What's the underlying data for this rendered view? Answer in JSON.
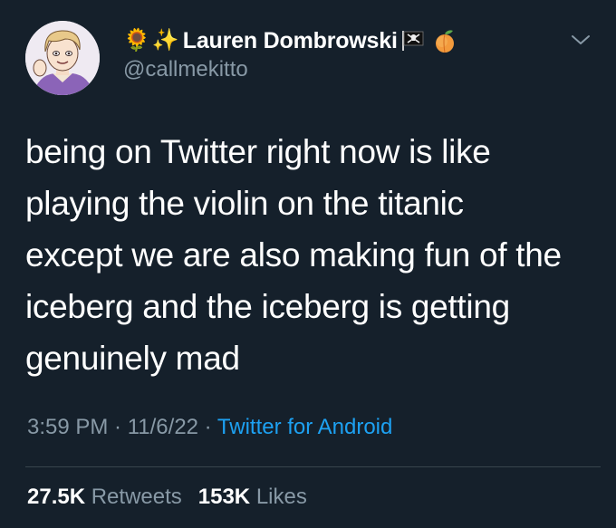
{
  "author": {
    "prefix_emojis": [
      "🌻",
      "✨"
    ],
    "display_name": "Lauren Dombrowski",
    "suffix_icons": [
      "pirate-flag-icon",
      "peach-icon"
    ],
    "handle": "@callmekitto"
  },
  "tweet": {
    "lines": [
      "being on Twitter right now is like",
      "playing the violin on the titanic",
      "except we are also making fun of the",
      "iceberg and the iceberg is getting",
      "genuinely mad"
    ]
  },
  "meta": {
    "time": "3:59 PM",
    "separator": " · ",
    "date": "11/6/22",
    "source": "Twitter for Android"
  },
  "stats": {
    "retweets_count": "27.5K",
    "retweets_label": "Retweets",
    "likes_count": "153K",
    "likes_label": "Likes"
  },
  "colors": {
    "background": "#15202b",
    "secondary_text": "#8899a6",
    "link": "#1da1f2",
    "divider": "#38444d"
  }
}
